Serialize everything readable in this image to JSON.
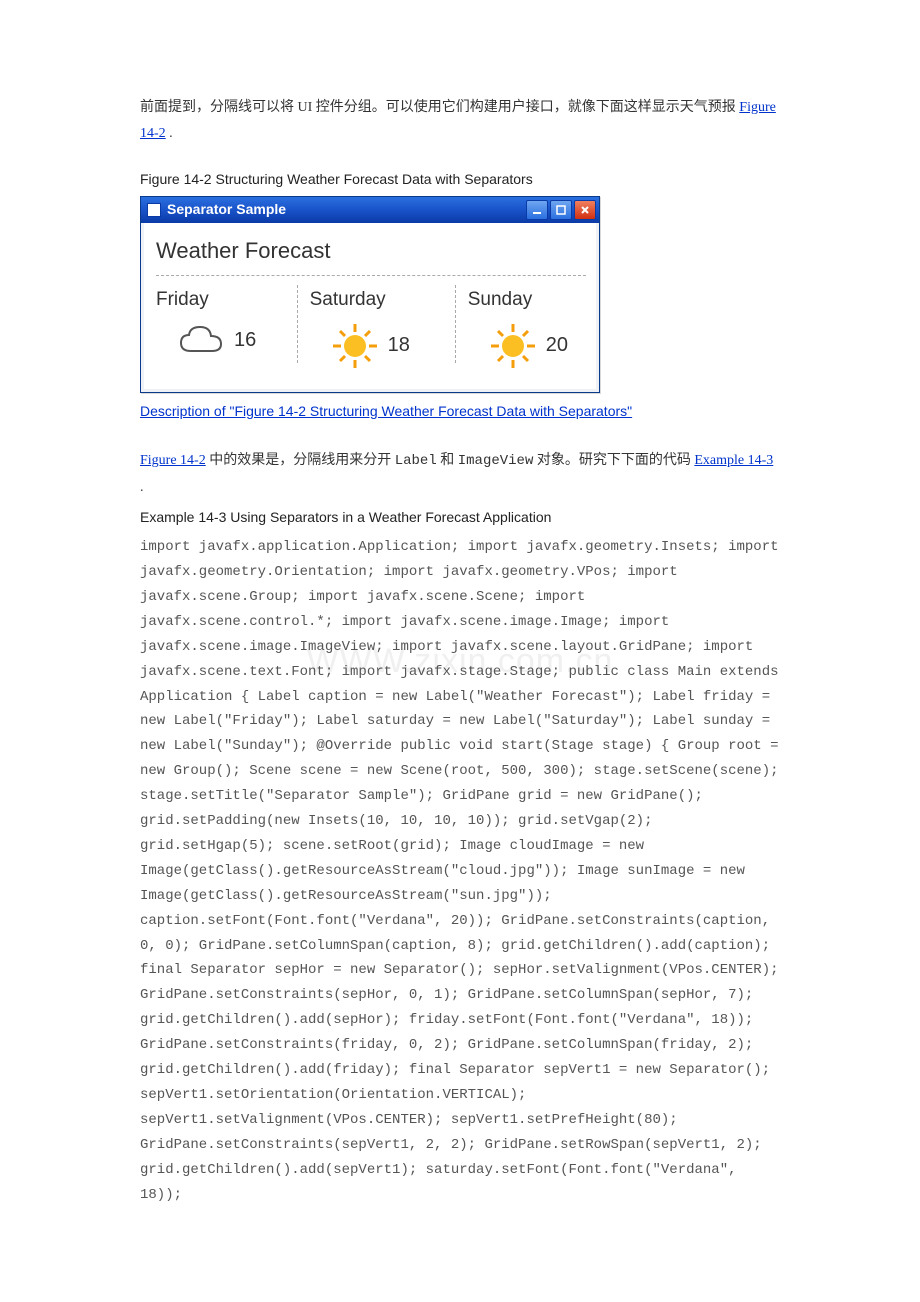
{
  "intro": {
    "zh1": "前面提到，分隔线可以将 UI 控件分组。可以使用它们构建用户接口，就像下面这样显示天气预报 ",
    "link1": "Figure 14-2",
    "zh2": " ."
  },
  "figure": {
    "caption": "Figure 14-2 Structuring Weather Forecast Data with Separators",
    "window_title": "Separator Sample",
    "wf_title": "Weather Forecast",
    "days": [
      {
        "label": "Friday",
        "icon": "cloud",
        "temp": "16"
      },
      {
        "label": "Saturday",
        "icon": "sun",
        "temp": "18"
      },
      {
        "label": "Sunday",
        "icon": "sun",
        "temp": "20"
      }
    ],
    "desc_link": "Description of \"Figure 14-2 Structuring Weather Forecast Data with Separators\""
  },
  "mid": {
    "link1": "Figure 14-2",
    "zh1": " 中的效果是，分隔线用来分开 ",
    "code1": "Label",
    "zh2": " 和 ",
    "code2": "ImageView",
    "zh3": " 对象。研究下下面的代码 ",
    "link2": "Example 14-3",
    "zh4": " ."
  },
  "example": {
    "title": "Example 14-3 Using Separators in a Weather Forecast Application",
    "code": "import javafx.application.Application; import javafx.geometry.Insets; import javafx.geometry.Orientation; import javafx.geometry.VPos; import javafx.scene.Group; import javafx.scene.Scene; import javafx.scene.control.*; import javafx.scene.image.Image; import javafx.scene.image.ImageView; import javafx.scene.layout.GridPane; import javafx.scene.text.Font; import javafx.stage.Stage; public class Main extends Application { Label caption = new Label(\"Weather Forecast\"); Label friday = new Label(\"Friday\"); Label saturday = new Label(\"Saturday\"); Label sunday = new Label(\"Sunday\"); @Override public void start(Stage stage) { Group root = new Group(); Scene scene = new Scene(root, 500, 300); stage.setScene(scene); stage.setTitle(\"Separator Sample\"); GridPane grid = new GridPane(); grid.setPadding(new Insets(10, 10, 10, 10)); grid.setVgap(2); grid.setHgap(5); scene.setRoot(grid); Image cloudImage = new Image(getClass().getResourceAsStream(\"cloud.jpg\")); Image sunImage = new Image(getClass().getResourceAsStream(\"sun.jpg\")); caption.setFont(Font.font(\"Verdana\", 20)); GridPane.setConstraints(caption, 0, 0); GridPane.setColumnSpan(caption, 8); grid.getChildren().add(caption); final Separator sepHor = new Separator(); sepHor.setValignment(VPos.CENTER); GridPane.setConstraints(sepHor, 0, 1); GridPane.setColumnSpan(sepHor, 7); grid.getChildren().add(sepHor); friday.setFont(Font.font(\"Verdana\", 18)); GridPane.setConstraints(friday, 0, 2); GridPane.setColumnSpan(friday, 2); grid.getChildren().add(friday); final Separator sepVert1 = new Separator(); sepVert1.setOrientation(Orientation.VERTICAL); sepVert1.setValignment(VPos.CENTER); sepVert1.setPrefHeight(80); GridPane.setConstraints(sepVert1, 2, 2); GridPane.setRowSpan(sepVert1, 2); grid.getChildren().add(sepVert1); saturday.setFont(Font.font(\"Verdana\", 18));"
  },
  "watermark": "WWW.zixin.com.cn"
}
